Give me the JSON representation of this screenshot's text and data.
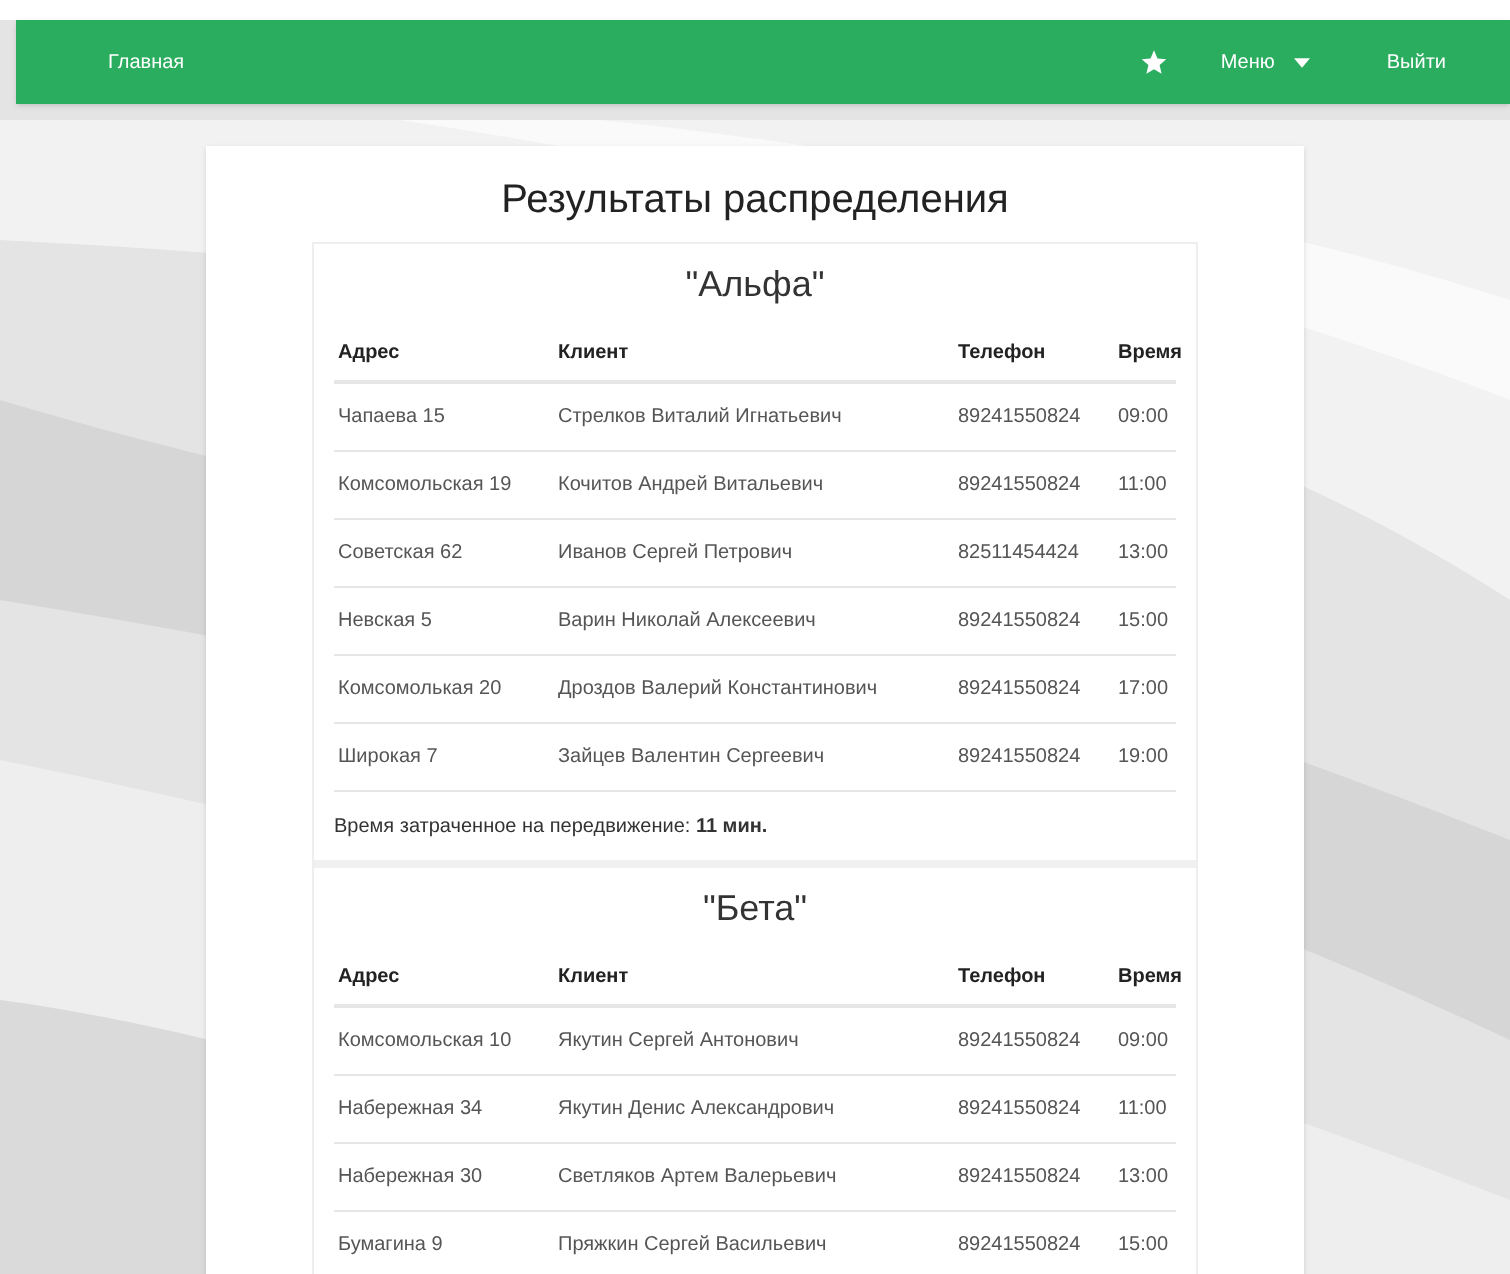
{
  "navbar": {
    "home": "Главная",
    "menu": "Меню",
    "logout": "Выйти"
  },
  "title": "Результаты распределения",
  "groups": [
    {
      "name": "\"Альфа\"",
      "columns": [
        "Адрес",
        "Клиент",
        "Телефон",
        "Время"
      ],
      "rows": [
        [
          "Чапаева 15",
          "Стрелков Виталий Игнатьевич",
          "89241550824",
          "09:00"
        ],
        [
          "Комсомольская 19",
          "Кочитов Андрей Витальевич",
          "89241550824",
          "11:00"
        ],
        [
          "Советская 62",
          "Иванов Сергей Петрович",
          "82511454424",
          "13:00"
        ],
        [
          "Невская 5",
          "Варин Николай Алексеевич",
          "89241550824",
          "15:00"
        ],
        [
          "Комсомолькая 20",
          "Дроздов Валерий Константинович",
          "89241550824",
          "17:00"
        ],
        [
          "Широкая 7",
          "Зайцев Валентин Сергеевич",
          "89241550824",
          "19:00"
        ]
      ],
      "summary": "Время затраченное на передвижение: **11 мин.**"
    },
    {
      "name": "\"Бета\"",
      "columns": [
        "Адрес",
        "Клиент",
        "Телефон",
        "Время"
      ],
      "rows": [
        [
          "Комсомольская 10",
          "Якутин Сергей Антонович",
          "89241550824",
          "09:00"
        ],
        [
          "Набережная 34",
          "Якутин Денис Александрович",
          "89241550824",
          "11:00"
        ],
        [
          "Набережная 30",
          "Светляков Артем Валерьевич",
          "89241550824",
          "13:00"
        ],
        [
          "Бумагина 9",
          "Пряжкин Сергей Васильевич",
          "89241550824",
          "15:00"
        ]
      ]
    }
  ]
}
